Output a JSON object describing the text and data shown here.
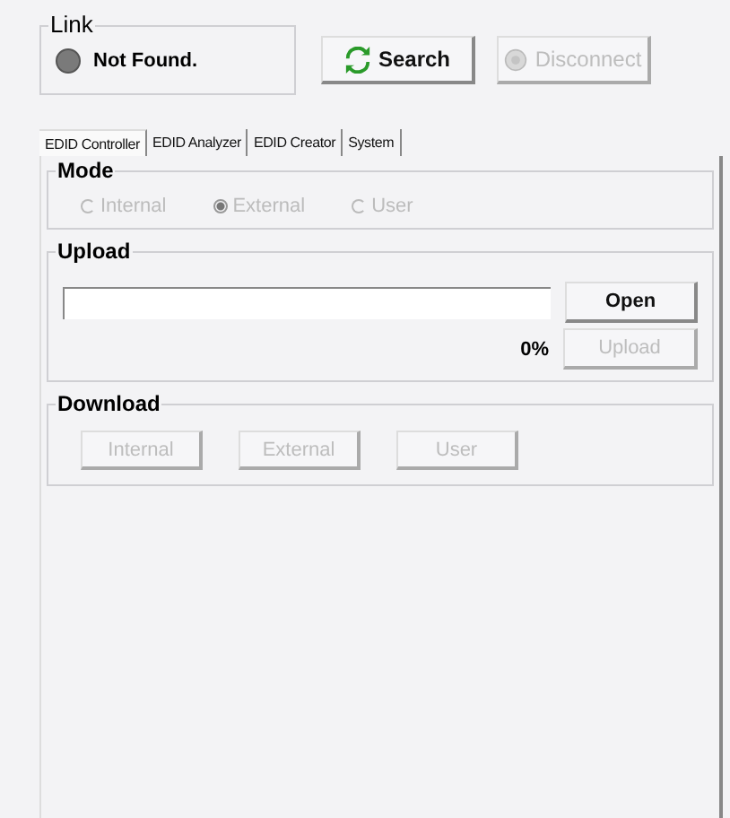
{
  "link": {
    "title": "Link",
    "status": "Not Found.",
    "connected": false
  },
  "buttons": [
    {
      "kind": "search",
      "label": "Search",
      "disabled": false
    },
    {
      "kind": "disconnect",
      "label": "Disconnect",
      "disabled": true
    }
  ],
  "tabs": [
    {
      "label": "EDID Controller",
      "selected": true
    },
    {
      "label": "EDID Analyzer",
      "selected": false
    },
    {
      "label": "EDID Creator",
      "selected": false
    },
    {
      "label": "System",
      "selected": false
    }
  ],
  "mode": {
    "title": "Mode",
    "disabled": true,
    "options": [
      {
        "label": "Internal",
        "selected": false
      },
      {
        "label": "External",
        "selected": true
      },
      {
        "label": "User",
        "selected": false
      }
    ]
  },
  "upload": {
    "title": "Upload",
    "open_button": {
      "label": "Open",
      "disabled": false
    },
    "progress": "0%",
    "upload_button": {
      "label": "Upload",
      "disabled": true
    }
  },
  "download": {
    "title": "Download",
    "buttons": [
      {
        "label": "Internal",
        "disabled": true
      },
      {
        "label": "External",
        "disabled": true
      },
      {
        "label": "User",
        "disabled": true
      }
    ]
  }
}
